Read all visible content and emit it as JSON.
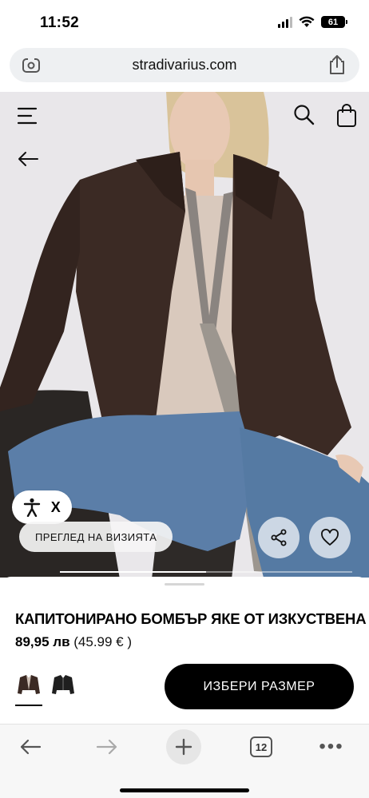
{
  "status_bar": {
    "time": "11:52",
    "battery": "61",
    "icons": [
      "cellular-signal-icon",
      "wifi-icon",
      "battery-icon"
    ]
  },
  "browser": {
    "url": "stradivarius.com",
    "left_icon": "page-settings-icon",
    "right_icon": "share-icon"
  },
  "hero": {
    "icons": {
      "menu": "hamburger-menu-icon",
      "search": "search-icon",
      "bag": "shopping-bag-icon",
      "back": "arrow-left-icon",
      "accessibility": "accessibility-person-icon",
      "share": "share-nodes-icon",
      "favorite": "heart-icon"
    },
    "accessibility_close": "X",
    "visit_chip": "ПРЕГЛЕД НА ВИЗИЯТА",
    "carousel_progress": 0.5
  },
  "product": {
    "title": "КАПИТОНИРАНО БОМБЪР ЯКЕ ОТ ИЗКУСТВЕНА ...",
    "price": "89,95 лв",
    "price_alt": "(45.99 € )",
    "colors": [
      {
        "name": "brown",
        "hex": "#3b2a24",
        "selected": true
      },
      {
        "name": "black",
        "hex": "#1f1f1f",
        "selected": false
      }
    ],
    "size_button": "ИЗБЕРИ РАЗМЕР"
  },
  "toolbar": {
    "tabs_count": "12",
    "icons": [
      "arrow-left-icon",
      "arrow-right-icon",
      "plus-icon",
      "tabs-icon",
      "more-icon"
    ],
    "more_label": "•••"
  },
  "colors": {
    "accent": "#000000",
    "url_bar_bg": "#eef0f2",
    "jacket": "#3b2a24",
    "denim": "#5b7ea8",
    "backdrop": "#e9e7ea"
  }
}
